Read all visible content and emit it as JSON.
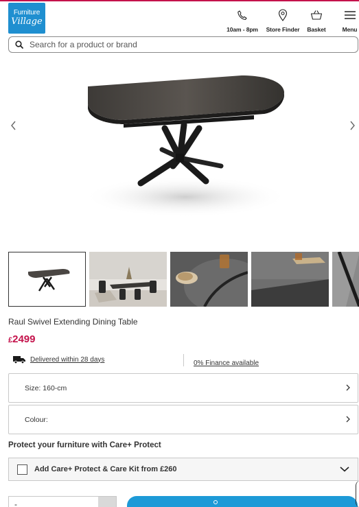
{
  "header": {
    "logo_line1": "Furniture",
    "logo_line2": "Village",
    "nav": [
      {
        "label": "10am - 8pm",
        "icon": "phone-icon"
      },
      {
        "label": "Store Finder",
        "icon": "location-pin-icon"
      },
      {
        "label": "Basket",
        "icon": "basket-icon"
      },
      {
        "label": "Menu",
        "icon": "hamburger-menu-icon"
      }
    ]
  },
  "search": {
    "placeholder": "Search for a product or brand",
    "value": ""
  },
  "gallery": {
    "prev_icon": "chevron-left-icon",
    "next_icon": "chevron-right-icon",
    "thumbnails": [
      "table-studio",
      "dining-room",
      "table-top-detail",
      "table-surface-detail",
      "table-leg-detail"
    ],
    "active_index": 0
  },
  "product": {
    "title": "Raul Swivel Extending Dining Table",
    "currency": "£",
    "price": "2499",
    "delivery": "Delivered within 28 days",
    "finance": "0% Finance available"
  },
  "options": {
    "size_label": "Size: 160-cm",
    "colour_label": "Colour:"
  },
  "protect": {
    "heading": "Protect your furniture with Care+ Protect",
    "care_label": "Add Care+ Protect & Care Kit from £260",
    "checked": false
  },
  "purchase": {
    "quantity_minus": "-"
  },
  "colors": {
    "brand_blue": "#1f8fd0",
    "price_red": "#c4124b",
    "button_blue": "#1d9ad7"
  }
}
